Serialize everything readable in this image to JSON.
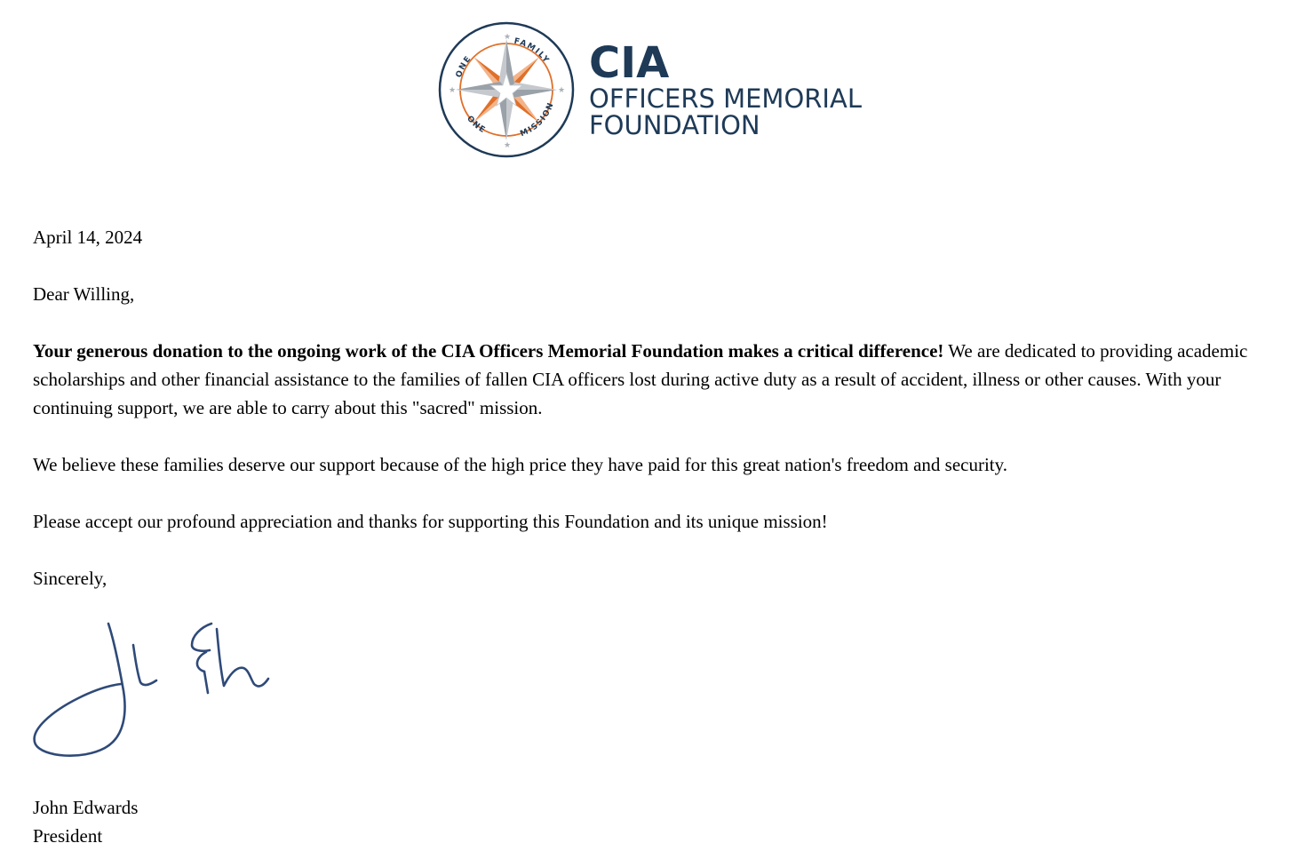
{
  "letterhead": {
    "org_short": "CIA",
    "org_line1": "OFFICERS MEMORIAL",
    "org_line2": "FOUNDATION",
    "seal_text_top_left": "ONE",
    "seal_text_top_right": "FAMILY",
    "seal_text_bottom_left": "ONE",
    "seal_text_bottom_right": "MISSION",
    "colors": {
      "navy": "#1e3a57",
      "orange": "#e0702a",
      "silver": "#c5c9cd"
    }
  },
  "letter": {
    "date": "April 14, 2024",
    "salutation": "Dear Willing,",
    "para1_bold": "Your generous donation to the ongoing work of the CIA Officers Memorial Foundation makes a critical difference!",
    "para1_rest": " We are dedicated to providing academic scholarships and other financial assistance to the families of fallen CIA officers lost during active duty as a result of accident, illness or other causes. With your continuing support, we are able to carry about this \"sacred\" mission.",
    "para2": "We believe these families deserve our support because of the high price they have paid for this great nation's freedom and security.",
    "para3": "Please accept our profound appreciation and thanks for supporting this Foundation and its unique mission!",
    "closing": "Sincerely,",
    "signer_name": "John Edwards",
    "signer_title": "President",
    "signature_color": "#2f4a78"
  }
}
